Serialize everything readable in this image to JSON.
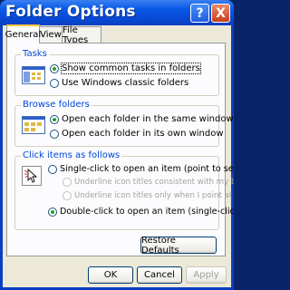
{
  "window": {
    "title": "Folder Options",
    "help_glyph": "?",
    "close_glyph": "X"
  },
  "tabs": [
    {
      "label": "General",
      "active": true
    },
    {
      "label": "View",
      "active": false
    },
    {
      "label": "File Types",
      "active": false
    }
  ],
  "tasks": {
    "label": "Tasks",
    "icon": "tasks-folder-icon",
    "options": [
      "Show common tasks in folders",
      "Use Windows classic folders"
    ],
    "selected": 0
  },
  "browse": {
    "label": "Browse folders",
    "icon": "browse-folder-icon",
    "options": [
      "Open each folder in the same window",
      "Open each folder in its own window"
    ],
    "selected": 0
  },
  "click": {
    "label": "Click items as follows",
    "icon": "click-cursor-icon",
    "options": [
      "Single-click to open an item (point to select)",
      "Underline icon titles consistent with my browser",
      "Underline icon titles only when I point at them",
      "Double-click to open an item (single-click to select)"
    ],
    "selected": 3
  },
  "restore_label": "Restore Defaults",
  "buttons": {
    "ok": "OK",
    "cancel": "Cancel",
    "apply": "Apply"
  },
  "colors": {
    "title_bar": "#0a5ae8",
    "group_label": "#0046d5",
    "radio_dot": "#21a121",
    "tab_highlight": "#ffc83c"
  }
}
